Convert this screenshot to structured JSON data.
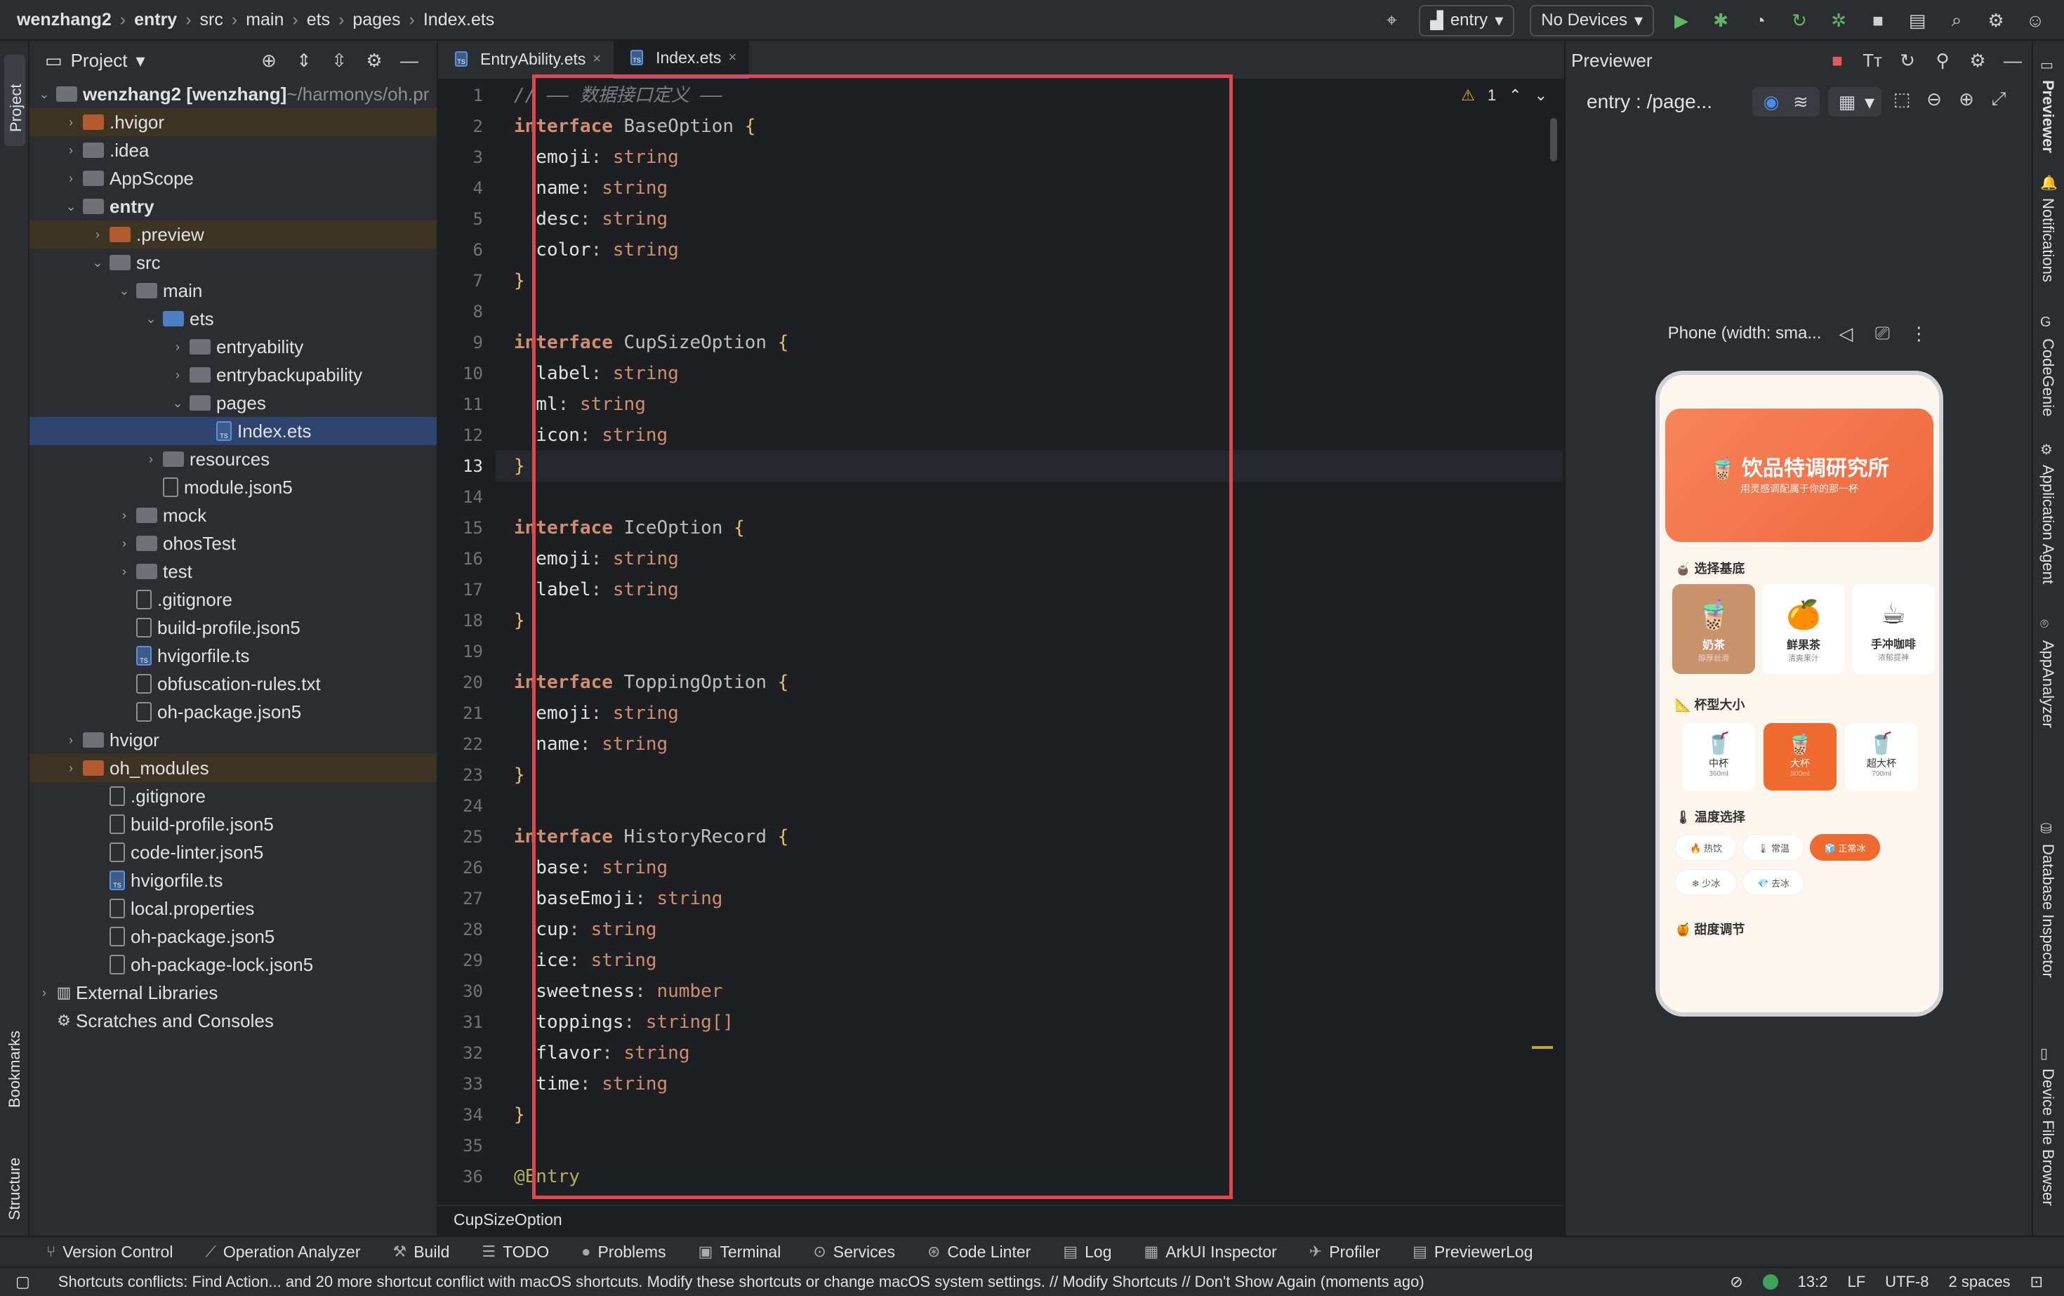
{
  "breadcrumb": [
    "wenzhang2",
    "entry",
    "src",
    "main",
    "ets",
    "pages",
    "Index.ets"
  ],
  "toolbar": {
    "run_config": "entry",
    "device": "No Devices"
  },
  "left_strip": {
    "top": "Project",
    "mid": "Bookmarks",
    "bottom": "Structure"
  },
  "project_panel": {
    "title": "Project",
    "tree": [
      {
        "label": "wenzhang2 [wenzhang]",
        "suffix": " ~/harmonys/oh.pr",
        "depth": 0,
        "kind": "root",
        "arrow": "open"
      },
      {
        "label": ".hvigor",
        "depth": 1,
        "kind": "folder-orange",
        "arrow": "closed",
        "hl": true
      },
      {
        "label": ".idea",
        "depth": 1,
        "kind": "folder",
        "arrow": "closed"
      },
      {
        "label": "AppScope",
        "depth": 1,
        "kind": "folder",
        "arrow": "closed"
      },
      {
        "label": "entry",
        "depth": 1,
        "kind": "folder",
        "arrow": "open",
        "bold": true
      },
      {
        "label": ".preview",
        "depth": 2,
        "kind": "folder-orange",
        "arrow": "closed",
        "hl": true
      },
      {
        "label": "src",
        "depth": 2,
        "kind": "folder",
        "arrow": "open"
      },
      {
        "label": "main",
        "depth": 3,
        "kind": "folder",
        "arrow": "open"
      },
      {
        "label": "ets",
        "depth": 4,
        "kind": "folder-blue",
        "arrow": "open"
      },
      {
        "label": "entryability",
        "depth": 5,
        "kind": "folder",
        "arrow": "closed"
      },
      {
        "label": "entrybackupability",
        "depth": 5,
        "kind": "folder",
        "arrow": "closed"
      },
      {
        "label": "pages",
        "depth": 5,
        "kind": "folder",
        "arrow": "open"
      },
      {
        "label": "Index.ets",
        "depth": 6,
        "kind": "ts",
        "arrow": "",
        "sel": true
      },
      {
        "label": "resources",
        "depth": 4,
        "kind": "folder",
        "arrow": "closed"
      },
      {
        "label": "module.json5",
        "depth": 4,
        "kind": "file",
        "arrow": ""
      },
      {
        "label": "mock",
        "depth": 3,
        "kind": "folder",
        "arrow": "closed"
      },
      {
        "label": "ohosTest",
        "depth": 3,
        "kind": "folder",
        "arrow": "closed"
      },
      {
        "label": "test",
        "depth": 3,
        "kind": "folder",
        "arrow": "closed"
      },
      {
        "label": ".gitignore",
        "depth": 3,
        "kind": "file",
        "arrow": ""
      },
      {
        "label": "build-profile.json5",
        "depth": 3,
        "kind": "file",
        "arrow": ""
      },
      {
        "label": "hvigorfile.ts",
        "depth": 3,
        "kind": "ts",
        "arrow": ""
      },
      {
        "label": "obfuscation-rules.txt",
        "depth": 3,
        "kind": "file",
        "arrow": ""
      },
      {
        "label": "oh-package.json5",
        "depth": 3,
        "kind": "file",
        "arrow": ""
      },
      {
        "label": "hvigor",
        "depth": 1,
        "kind": "folder",
        "arrow": "closed"
      },
      {
        "label": "oh_modules",
        "depth": 1,
        "kind": "folder-orange",
        "arrow": "closed",
        "hl": true
      },
      {
        "label": ".gitignore",
        "depth": 2,
        "kind": "file",
        "arrow": ""
      },
      {
        "label": "build-profile.json5",
        "depth": 2,
        "kind": "file",
        "arrow": ""
      },
      {
        "label": "code-linter.json5",
        "depth": 2,
        "kind": "file",
        "arrow": ""
      },
      {
        "label": "hvigorfile.ts",
        "depth": 2,
        "kind": "ts",
        "arrow": ""
      },
      {
        "label": "local.properties",
        "depth": 2,
        "kind": "file",
        "arrow": ""
      },
      {
        "label": "oh-package.json5",
        "depth": 2,
        "kind": "file",
        "arrow": ""
      },
      {
        "label": "oh-package-lock.json5",
        "depth": 2,
        "kind": "file",
        "arrow": ""
      },
      {
        "label": "External Libraries",
        "depth": 0,
        "kind": "lib",
        "arrow": "closed"
      },
      {
        "label": "Scratches and Consoles",
        "depth": 0,
        "kind": "scratch",
        "arrow": ""
      }
    ]
  },
  "editor": {
    "tabs": [
      {
        "label": "EntryAbility.ets",
        "active": false
      },
      {
        "label": "Index.ets",
        "active": true
      }
    ],
    "inspection": {
      "warnings": "1"
    },
    "current_line": 13,
    "lines": [
      [
        {
          "t": "cm",
          "v": "// —— 数据接口定义 ——"
        }
      ],
      [
        {
          "t": "kw",
          "v": "interface "
        },
        {
          "t": "ty",
          "v": "BaseOption "
        },
        {
          "t": "brk",
          "v": "{"
        }
      ],
      [
        {
          "t": "id",
          "v": "  emoji"
        },
        {
          "t": "ty",
          "v": ": "
        },
        {
          "t": "prim",
          "v": "string"
        }
      ],
      [
        {
          "t": "id",
          "v": "  name"
        },
        {
          "t": "ty",
          "v": ": "
        },
        {
          "t": "prim",
          "v": "string"
        }
      ],
      [
        {
          "t": "id",
          "v": "  desc"
        },
        {
          "t": "ty",
          "v": ": "
        },
        {
          "t": "prim",
          "v": "string"
        }
      ],
      [
        {
          "t": "id",
          "v": "  color"
        },
        {
          "t": "ty",
          "v": ": "
        },
        {
          "t": "prim",
          "v": "string"
        }
      ],
      [
        {
          "t": "brk",
          "v": "}"
        }
      ],
      [],
      [
        {
          "t": "kw",
          "v": "interface "
        },
        {
          "t": "ty",
          "v": "CupSizeOption "
        },
        {
          "t": "brk",
          "v": "{"
        }
      ],
      [
        {
          "t": "id",
          "v": "  label"
        },
        {
          "t": "ty",
          "v": ": "
        },
        {
          "t": "prim",
          "v": "string"
        }
      ],
      [
        {
          "t": "id",
          "v": "  ml"
        },
        {
          "t": "ty",
          "v": ": "
        },
        {
          "t": "prim",
          "v": "string"
        }
      ],
      [
        {
          "t": "id",
          "v": "  icon"
        },
        {
          "t": "ty",
          "v": ": "
        },
        {
          "t": "prim",
          "v": "string"
        }
      ],
      [
        {
          "t": "brk",
          "v": "}"
        }
      ],
      [],
      [
        {
          "t": "kw",
          "v": "interface "
        },
        {
          "t": "ty",
          "v": "IceOption "
        },
        {
          "t": "brk",
          "v": "{"
        }
      ],
      [
        {
          "t": "id",
          "v": "  emoji"
        },
        {
          "t": "ty",
          "v": ": "
        },
        {
          "t": "prim",
          "v": "string"
        }
      ],
      [
        {
          "t": "id",
          "v": "  label"
        },
        {
          "t": "ty",
          "v": ": "
        },
        {
          "t": "prim",
          "v": "string"
        }
      ],
      [
        {
          "t": "brk",
          "v": "}"
        }
      ],
      [],
      [
        {
          "t": "kw",
          "v": "interface "
        },
        {
          "t": "ty",
          "v": "ToppingOption "
        },
        {
          "t": "brk",
          "v": "{"
        }
      ],
      [
        {
          "t": "id",
          "v": "  emoji"
        },
        {
          "t": "ty",
          "v": ": "
        },
        {
          "t": "prim",
          "v": "string"
        }
      ],
      [
        {
          "t": "id",
          "v": "  name"
        },
        {
          "t": "ty",
          "v": ": "
        },
        {
          "t": "prim",
          "v": "string"
        }
      ],
      [
        {
          "t": "brk",
          "v": "}"
        }
      ],
      [],
      [
        {
          "t": "kw",
          "v": "interface "
        },
        {
          "t": "ty",
          "v": "HistoryRecord "
        },
        {
          "t": "brk",
          "v": "{"
        }
      ],
      [
        {
          "t": "id",
          "v": "  base"
        },
        {
          "t": "ty",
          "v": ": "
        },
        {
          "t": "prim",
          "v": "string"
        }
      ],
      [
        {
          "t": "id",
          "v": "  baseEmoji"
        },
        {
          "t": "ty",
          "v": ": "
        },
        {
          "t": "prim",
          "v": "string"
        }
      ],
      [
        {
          "t": "id",
          "v": "  cup"
        },
        {
          "t": "ty",
          "v": ": "
        },
        {
          "t": "prim",
          "v": "string"
        }
      ],
      [
        {
          "t": "id",
          "v": "  ice"
        },
        {
          "t": "ty",
          "v": ": "
        },
        {
          "t": "prim",
          "v": "string"
        }
      ],
      [
        {
          "t": "id",
          "v": "  sweetness"
        },
        {
          "t": "ty",
          "v": ": "
        },
        {
          "t": "prim",
          "v": "number"
        }
      ],
      [
        {
          "t": "id",
          "v": "  toppings"
        },
        {
          "t": "ty",
          "v": ": "
        },
        {
          "t": "prim",
          "v": "string[]"
        }
      ],
      [
        {
          "t": "id",
          "v": "  flavor"
        },
        {
          "t": "ty",
          "v": ": "
        },
        {
          "t": "prim",
          "v": "string"
        }
      ],
      [
        {
          "t": "id",
          "v": "  time"
        },
        {
          "t": "ty",
          "v": ": "
        },
        {
          "t": "prim",
          "v": "string"
        }
      ],
      [
        {
          "t": "brk",
          "v": "}"
        }
      ],
      [],
      [
        {
          "t": "an",
          "v": "@Entry"
        }
      ]
    ],
    "breadcrumb_bottom": "CupSizeOption"
  },
  "previewer": {
    "title": "Previewer",
    "route": "entry : /page...",
    "device_label": "Phone (width: sma...",
    "app": {
      "title": "🧋 饮品特调研究所",
      "subtitle": "用灵感调配属于你的那一杯",
      "section_base": "🧉 选择基底",
      "bases": [
        {
          "emoji": "🧋",
          "name": "奶茶",
          "desc": "醇厚丝滑",
          "selected": true
        },
        {
          "emoji": "🍊",
          "name": "鲜果茶",
          "desc": "清爽果汁",
          "selected": false
        },
        {
          "emoji": "☕",
          "name": "手冲咖啡",
          "desc": "浓郁提神",
          "selected": false
        }
      ],
      "section_cup": "📐 杯型大小",
      "cups": [
        {
          "emoji": "🥤",
          "name": "中杯",
          "ml": "360ml",
          "selected": false
        },
        {
          "emoji": "🧋",
          "name": "大杯",
          "ml": "500ml",
          "selected": true
        },
        {
          "emoji": "🥤",
          "name": "超大杯",
          "ml": "700ml",
          "selected": false
        }
      ],
      "section_temp": "🌡 温度选择",
      "temps": [
        {
          "label": "🔥 热饮",
          "selected": false
        },
        {
          "label": "🌡 常温",
          "selected": false
        },
        {
          "label": "🧊 正常冰",
          "selected": true
        },
        {
          "label": "❄ 少冰",
          "selected": false
        },
        {
          "label": "💎 去冰",
          "selected": false
        }
      ],
      "section_sweet": "🍯 甜度调节"
    }
  },
  "right_strip": [
    "Previewer",
    "Notifications",
    "CodeGenie",
    "Application Agent",
    "AppAnalyzer",
    "Database Inspector",
    "Device File Browser"
  ],
  "bottom_tools": [
    "Version Control",
    "Operation Analyzer",
    "Build",
    "TODO",
    "Problems",
    "Terminal",
    "Services",
    "Code Linter",
    "Log",
    "ArkUI Inspector",
    "Profiler",
    "PreviewerLog"
  ],
  "status": {
    "message": "Shortcuts conflicts: Find Action... and 20 more shortcut conflict with macOS shortcuts. Modify these shortcuts or change macOS system settings. // Modify Shortcuts // Don't Show Again (moments ago)",
    "position": "13:2",
    "line_sep": "LF",
    "encoding": "UTF-8",
    "indent": "2 spaces"
  }
}
